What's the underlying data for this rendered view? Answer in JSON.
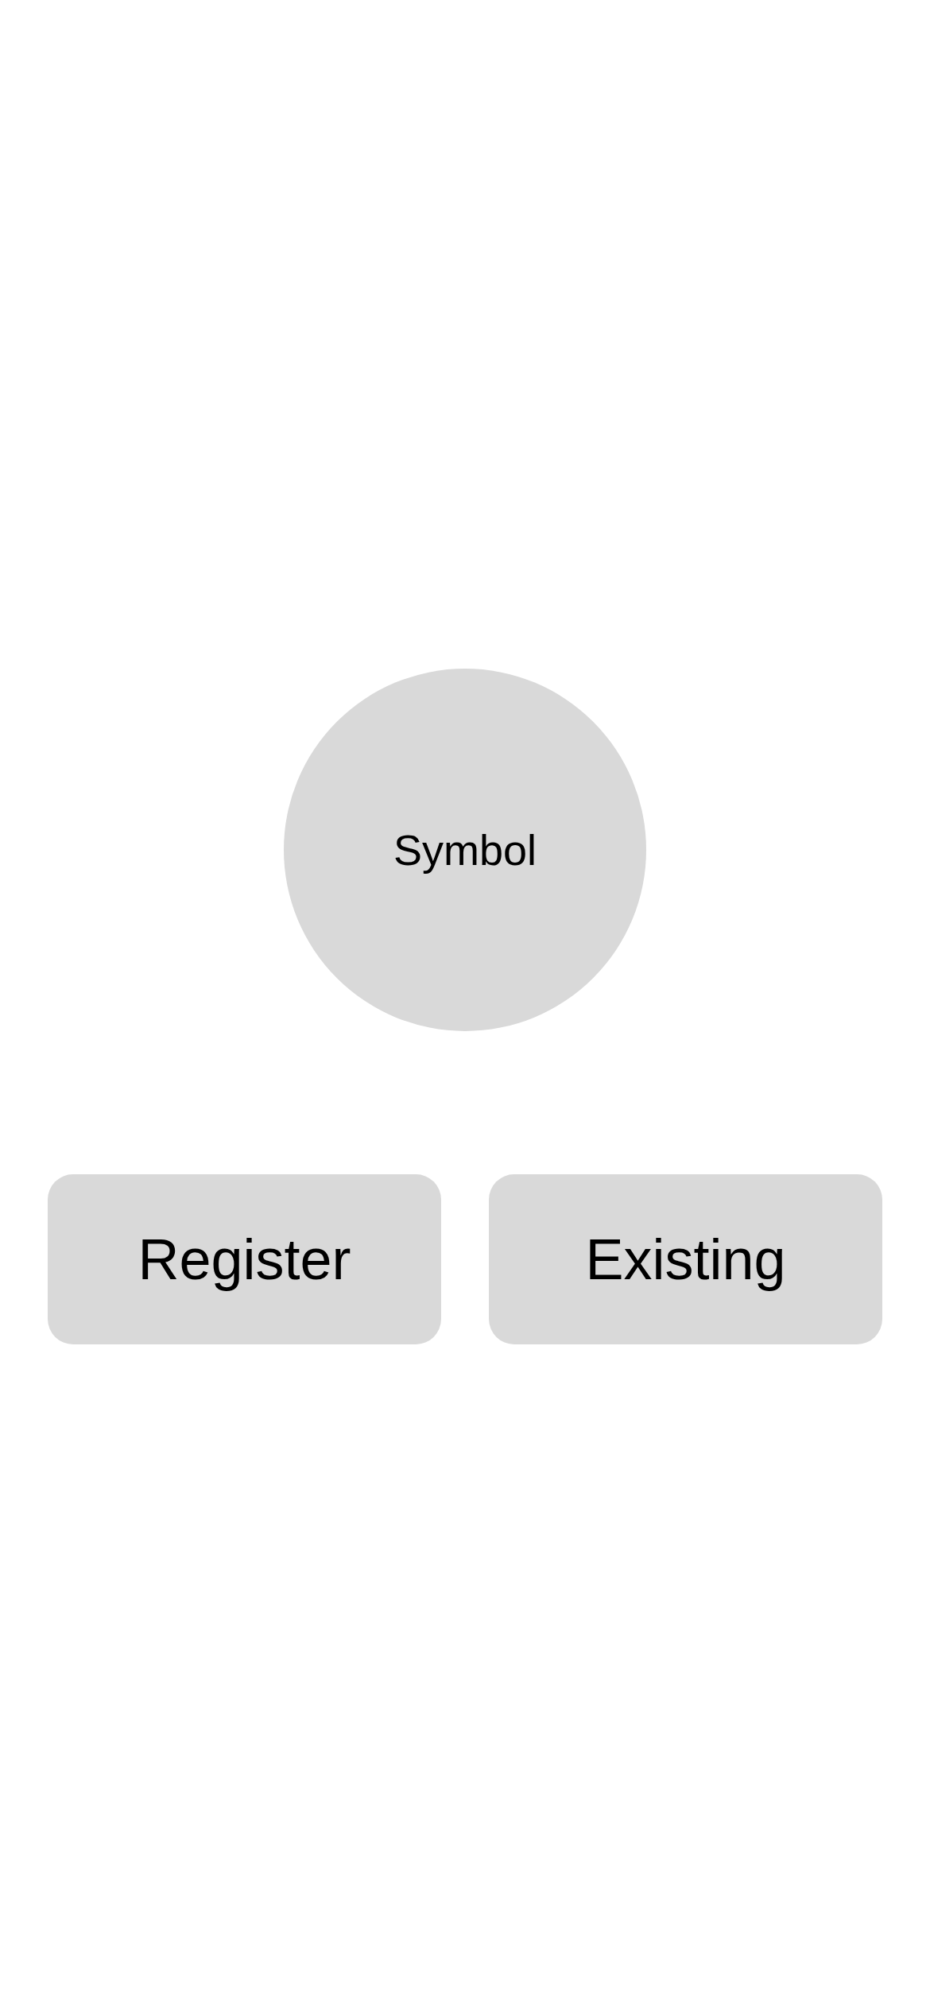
{
  "logo": {
    "label": "Symbol"
  },
  "buttons": [
    {
      "label": "Register"
    },
    {
      "label": "Existing"
    }
  ]
}
